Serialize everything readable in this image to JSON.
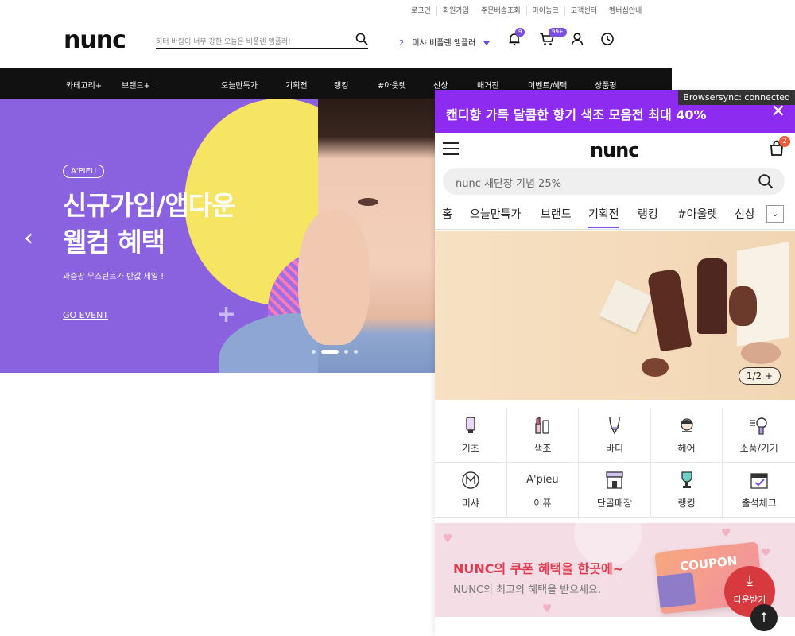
{
  "desktop": {
    "top_links": [
      "로그인",
      "회원가입",
      "주문배송조회",
      "마이눙크",
      "고객센터",
      "멤버십안내"
    ],
    "logo": "nunc",
    "search": {
      "placeholder": "히터 바람이 너무 강한 오늘은 비플렌 앰플러!"
    },
    "ranking": {
      "number": "2",
      "label": "미샤 비폴렌 앰플러"
    },
    "notification_badge": "9",
    "cart_badge": "99+",
    "nav": {
      "category": "카테고리+",
      "brand": "브랜드+",
      "items": [
        "오늘만특가",
        "기획전",
        "랭킹",
        "#아웃렛",
        "신상",
        "매거진",
        "이벤트/혜택",
        "상품평"
      ]
    },
    "hero": {
      "brand_tag": "A'PIEU",
      "title_line1": "신규가입/앱다운",
      "title_line2": "웰컴 혜택",
      "subtitle": "과즙팡 무스틴트가 반값 세일 !",
      "link": "GO EVENT",
      "prev_arrow": "‹"
    }
  },
  "mobile": {
    "top_banner": "캔디향 가득 달콤한 향기 색조 모음전 최대 40%",
    "close": "✕",
    "browsersync": "Browsersync: connected",
    "logo": "nunc",
    "cart_badge": "2",
    "search_placeholder": "nunc 새단장 기념 25%",
    "tabs": [
      "홈",
      "오늘만특가",
      "브랜드",
      "기획전",
      "랭킹",
      "#아울렛",
      "신상"
    ],
    "active_tab": "기획전",
    "more_icon": "⌄",
    "promo_pager": "1/2 +",
    "categories": [
      {
        "label": "기초",
        "icon": "tube-icon"
      },
      {
        "label": "색조",
        "icon": "lipstick-icon"
      },
      {
        "label": "바디",
        "icon": "body-icon"
      },
      {
        "label": "헤어",
        "icon": "hair-icon"
      },
      {
        "label": "소품/기기",
        "icon": "dryer-icon"
      },
      {
        "label": "미샤",
        "icon": "missha-logo-icon"
      },
      {
        "label": "어퓨",
        "icon": "apieu-logo-icon",
        "logo_text": "A'pieu"
      },
      {
        "label": "단골매장",
        "icon": "store-icon"
      },
      {
        "label": "랭킹",
        "icon": "trophy-icon"
      },
      {
        "label": "출석체크",
        "icon": "calendar-check-icon"
      }
    ],
    "coupon_banner": {
      "title": "NUNC의 쿠폰 혜택을 한곳에~",
      "subtitle": "NUNC의 최고의 혜택을 받으세요.",
      "card_text": "COUPON"
    },
    "download_button": {
      "arrow": "⤓",
      "label": "다운받기"
    },
    "top_button": "↑"
  },
  "colors": {
    "accent": "#7b4fe0",
    "hero_bg": "#8a62df",
    "top_banner_bg": "#8e2bf0",
    "nav_bg": "#111111",
    "coupon_red": "#e23b4f"
  }
}
